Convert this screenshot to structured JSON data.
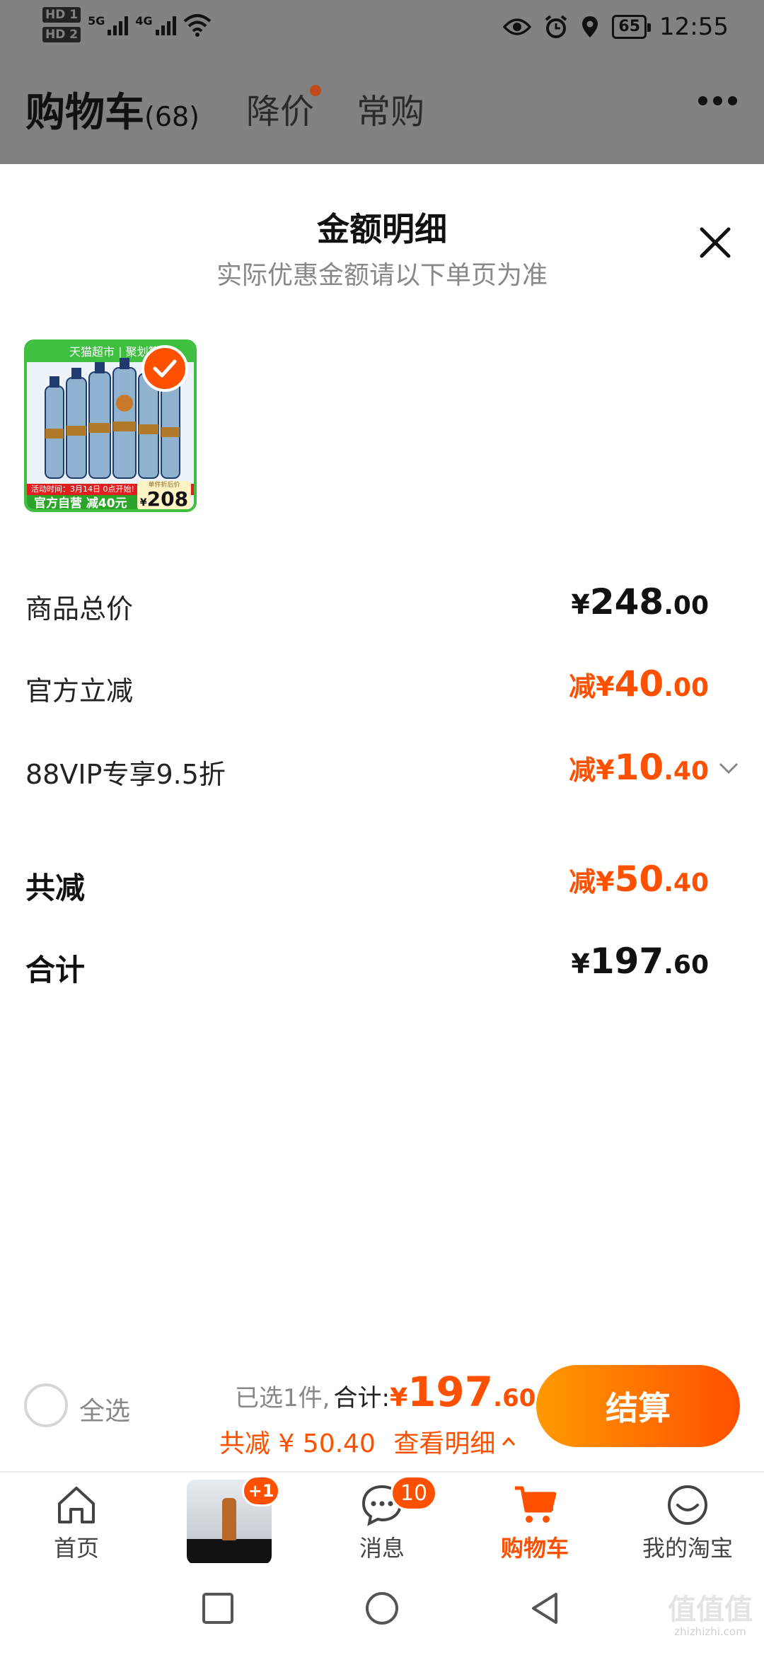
{
  "status_bar": {
    "hd1": "HD 1",
    "hd2": "HD 2",
    "net1": "5G",
    "net2": "4G",
    "battery": "65",
    "time": "12:55"
  },
  "header": {
    "title": "购物车",
    "count": "(68)",
    "tab_price_drop": "降价",
    "tab_frequent": "常购"
  },
  "sheet": {
    "title": "金额明细",
    "subtitle": "实际优惠金额请以下单页为准",
    "product_thumb": {
      "top_banner": "天猫超市 | 聚划算",
      "promo_strip": "活动时间：3月14日 0点开始!",
      "badge_left": "官方自营 减40元",
      "price_caption": "单件折后价",
      "price_currency": "¥",
      "price": "208"
    },
    "rows": [
      {
        "label": "商品总价",
        "prefix": "",
        "currency": "¥",
        "int": "248",
        "dec": ".00"
      },
      {
        "label": "官方立减",
        "prefix": "减",
        "currency": "¥",
        "int": "40",
        "dec": ".00"
      },
      {
        "label": "88VIP专享9.5折",
        "prefix": "减",
        "currency": "¥",
        "int": "10",
        "dec": ".40"
      },
      {
        "label": "共减",
        "prefix": "减",
        "currency": "¥",
        "int": "50",
        "dec": ".40"
      },
      {
        "label": "合计",
        "prefix": "",
        "currency": "¥",
        "int": "197",
        "dec": ".60"
      }
    ]
  },
  "checkout": {
    "select_all": "全选",
    "selected_count": "已选1件,",
    "total_label": "合计:",
    "total_currency": "¥",
    "total_int": "197",
    "total_dec": ".60",
    "discount_text": "共减 ¥ 50.40",
    "detail_link": "查看明细",
    "checkout_button": "结算"
  },
  "tab_bar": {
    "home": "首页",
    "live_badge": "+1",
    "messages": "消息",
    "messages_badge": "10",
    "cart": "购物车",
    "my_taobao": "我的淘宝"
  },
  "watermark": {
    "glyphs": "值值值",
    "site": "zhizhizhi.com"
  },
  "colors": {
    "accent": "#ff5000",
    "overlay": "#828282",
    "thumb_green": "#3fbf3f"
  }
}
